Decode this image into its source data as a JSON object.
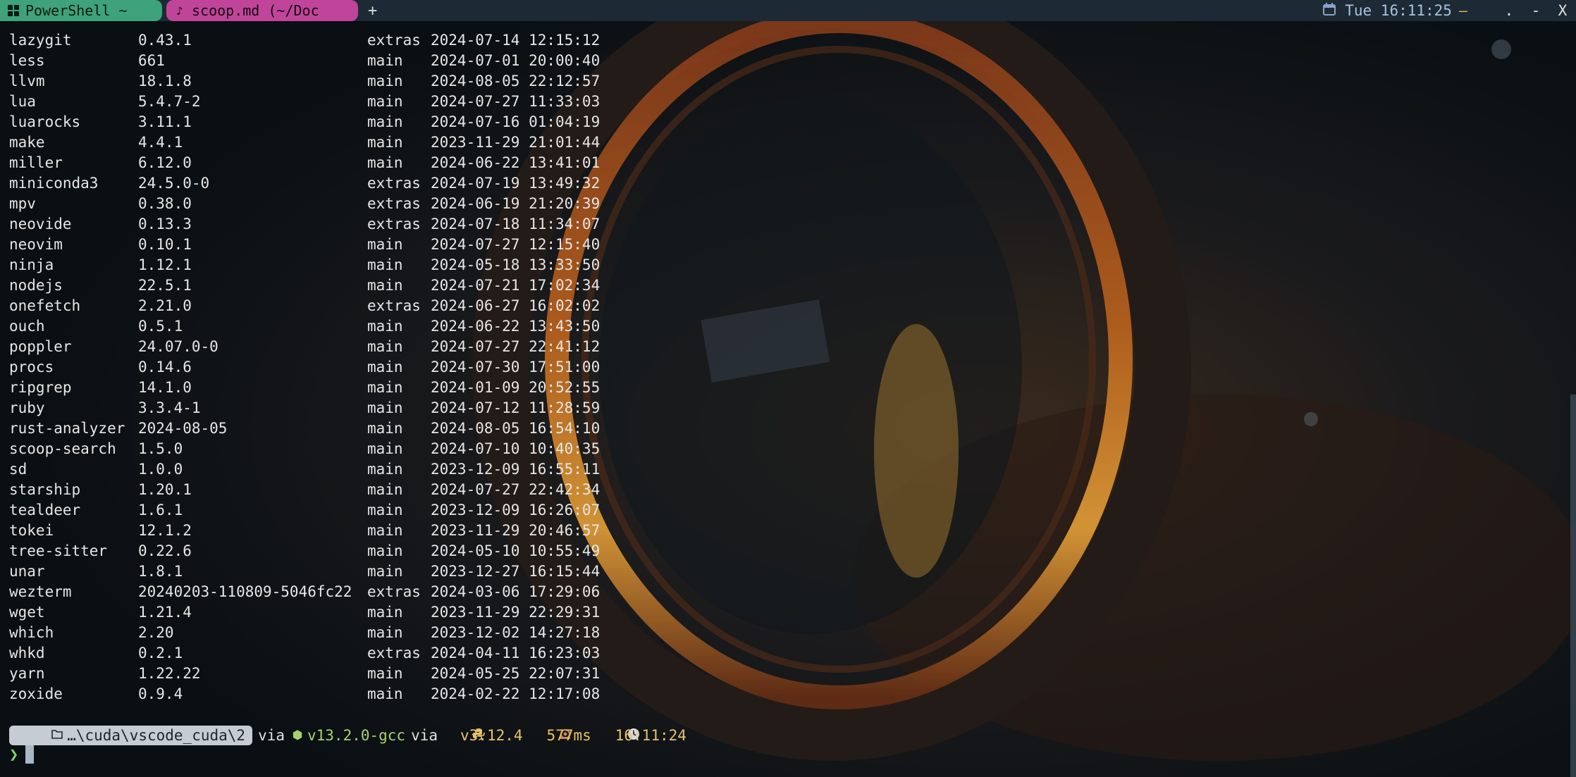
{
  "tabs": [
    {
      "label": "PowerShell ~",
      "icon": "windows-icon"
    },
    {
      "label": "scoop.md (~/Doc",
      "icon": "music-note-icon"
    }
  ],
  "new_tab_label": "+",
  "status": {
    "clock": "Tue 16:11:25",
    "dash": "—"
  },
  "window_controls": {
    "minimize_dot": ".",
    "minimize": "-",
    "close": "X"
  },
  "packages": [
    {
      "name": "lazygit",
      "version": "0.43.1",
      "source": "extras",
      "updated": "2024-07-14 12:15:12"
    },
    {
      "name": "less",
      "version": "661",
      "source": "main",
      "updated": "2024-07-01 20:00:40"
    },
    {
      "name": "llvm",
      "version": "18.1.8",
      "source": "main",
      "updated": "2024-08-05 22:12:57"
    },
    {
      "name": "lua",
      "version": "5.4.7-2",
      "source": "main",
      "updated": "2024-07-27 11:33:03"
    },
    {
      "name": "luarocks",
      "version": "3.11.1",
      "source": "main",
      "updated": "2024-07-16 01:04:19"
    },
    {
      "name": "make",
      "version": "4.4.1",
      "source": "main",
      "updated": "2023-11-29 21:01:44"
    },
    {
      "name": "miller",
      "version": "6.12.0",
      "source": "main",
      "updated": "2024-06-22 13:41:01"
    },
    {
      "name": "miniconda3",
      "version": "24.5.0-0",
      "source": "extras",
      "updated": "2024-07-19 13:49:32"
    },
    {
      "name": "mpv",
      "version": "0.38.0",
      "source": "extras",
      "updated": "2024-06-19 21:20:39"
    },
    {
      "name": "neovide",
      "version": "0.13.3",
      "source": "extras",
      "updated": "2024-07-18 11:34:07"
    },
    {
      "name": "neovim",
      "version": "0.10.1",
      "source": "main",
      "updated": "2024-07-27 12:15:40"
    },
    {
      "name": "ninja",
      "version": "1.12.1",
      "source": "main",
      "updated": "2024-05-18 13:33:50"
    },
    {
      "name": "nodejs",
      "version": "22.5.1",
      "source": "main",
      "updated": "2024-07-21 17:02:34"
    },
    {
      "name": "onefetch",
      "version": "2.21.0",
      "source": "extras",
      "updated": "2024-06-27 16:02:02"
    },
    {
      "name": "ouch",
      "version": "0.5.1",
      "source": "main",
      "updated": "2024-06-22 13:43:50"
    },
    {
      "name": "poppler",
      "version": "24.07.0-0",
      "source": "main",
      "updated": "2024-07-27 22:41:12"
    },
    {
      "name": "procs",
      "version": "0.14.6",
      "source": "main",
      "updated": "2024-07-30 17:51:00"
    },
    {
      "name": "ripgrep",
      "version": "14.1.0",
      "source": "main",
      "updated": "2024-01-09 20:52:55"
    },
    {
      "name": "ruby",
      "version": "3.3.4-1",
      "source": "main",
      "updated": "2024-07-12 11:28:59"
    },
    {
      "name": "rust-analyzer",
      "version": "2024-08-05",
      "source": "main",
      "updated": "2024-08-05 16:54:10"
    },
    {
      "name": "scoop-search",
      "version": "1.5.0",
      "source": "main",
      "updated": "2024-07-10 10:40:35"
    },
    {
      "name": "sd",
      "version": "1.0.0",
      "source": "main",
      "updated": "2023-12-09 16:55:11"
    },
    {
      "name": "starship",
      "version": "1.20.1",
      "source": "main",
      "updated": "2024-07-27 22:42:34"
    },
    {
      "name": "tealdeer",
      "version": "1.6.1",
      "source": "main",
      "updated": "2023-12-09 16:26:07"
    },
    {
      "name": "tokei",
      "version": "12.1.2",
      "source": "main",
      "updated": "2023-11-29 20:46:57"
    },
    {
      "name": "tree-sitter",
      "version": "0.22.6",
      "source": "main",
      "updated": "2024-05-10 10:55:49"
    },
    {
      "name": "unar",
      "version": "1.8.1",
      "source": "main",
      "updated": "2023-12-27 16:15:44"
    },
    {
      "name": "wezterm",
      "version": "20240203-110809-5046fc22",
      "source": "extras",
      "updated": "2024-03-06 17:29:06"
    },
    {
      "name": "wget",
      "version": "1.21.4",
      "source": "main",
      "updated": "2023-11-29 22:29:31"
    },
    {
      "name": "which",
      "version": "2.20",
      "source": "main",
      "updated": "2023-12-02 14:27:18"
    },
    {
      "name": "whkd",
      "version": "0.2.1",
      "source": "extras",
      "updated": "2024-04-11 16:23:03"
    },
    {
      "name": "yarn",
      "version": "1.22.22",
      "source": "main",
      "updated": "2024-05-25 22:07:31"
    },
    {
      "name": "zoxide",
      "version": "0.9.4",
      "source": "main",
      "updated": "2024-02-22 12:17:08"
    }
  ],
  "prompt": {
    "directory": "…\\cuda\\vscode_cuda\\2",
    "via1": "via",
    "gcc_version": "v13.2.0-gcc",
    "via2": "via",
    "python_version": "v3.12.4",
    "duration": "577ms",
    "time": "16:11:24",
    "symbol": "❯"
  },
  "colors": {
    "tab_powershell": "#3ea27a",
    "tab_scoop": "#c0459a",
    "tabbar": "#1d2a35",
    "prompt_green": "#79d86a",
    "gcc_green": "#a6d36a",
    "python_yellow": "#e8c46a"
  }
}
